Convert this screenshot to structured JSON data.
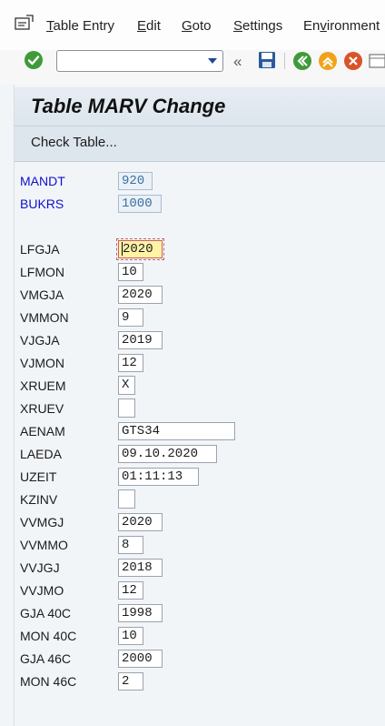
{
  "menu": {
    "items": [
      {
        "label": "Table Entry"
      },
      {
        "label": "Edit"
      },
      {
        "label": "Goto"
      },
      {
        "label": "Settings"
      },
      {
        "label": "Environment"
      }
    ]
  },
  "toolbar": {
    "command_value": "",
    "icons": [
      "enter-check-icon",
      "command-dropdown-icon",
      "collapse-icon",
      "save-icon",
      "back-icon",
      "exit-icon",
      "cancel-icon",
      "screen-icon"
    ]
  },
  "title": "Table MARV Change",
  "app_toolbar": {
    "check_table": "Check Table..."
  },
  "fields": [
    {
      "label": "MANDT",
      "value": "920",
      "key": true
    },
    {
      "label": "BUKRS",
      "value": "1000",
      "key": true
    },
    {
      "label": "LFGJA",
      "value": "2020",
      "focus": true
    },
    {
      "label": "LFMON",
      "value": "10"
    },
    {
      "label": "VMGJA",
      "value": "2020"
    },
    {
      "label": "VMMON",
      "value": "9"
    },
    {
      "label": "VJGJA",
      "value": "2019"
    },
    {
      "label": "VJMON",
      "value": "12"
    },
    {
      "label": "XRUEM",
      "value": "X"
    },
    {
      "label": "XRUEV",
      "value": ""
    },
    {
      "label": "AENAM",
      "value": "GTS34"
    },
    {
      "label": "LAEDA",
      "value": "09.10.2020"
    },
    {
      "label": "UZEIT",
      "value": "01:11:13"
    },
    {
      "label": "KZINV",
      "value": ""
    },
    {
      "label": "VVMGJ",
      "value": "2020"
    },
    {
      "label": "VVMMO",
      "value": "8"
    },
    {
      "label": "VVJGJ",
      "value": "2018"
    },
    {
      "label": "VVJMO",
      "value": "12"
    },
    {
      "label": "GJA 40C",
      "value": "1998"
    },
    {
      "label": "MON 40C",
      "value": "10"
    },
    {
      "label": "GJA 46C",
      "value": "2000"
    },
    {
      "label": "MON 46C",
      "value": "2"
    }
  ]
}
